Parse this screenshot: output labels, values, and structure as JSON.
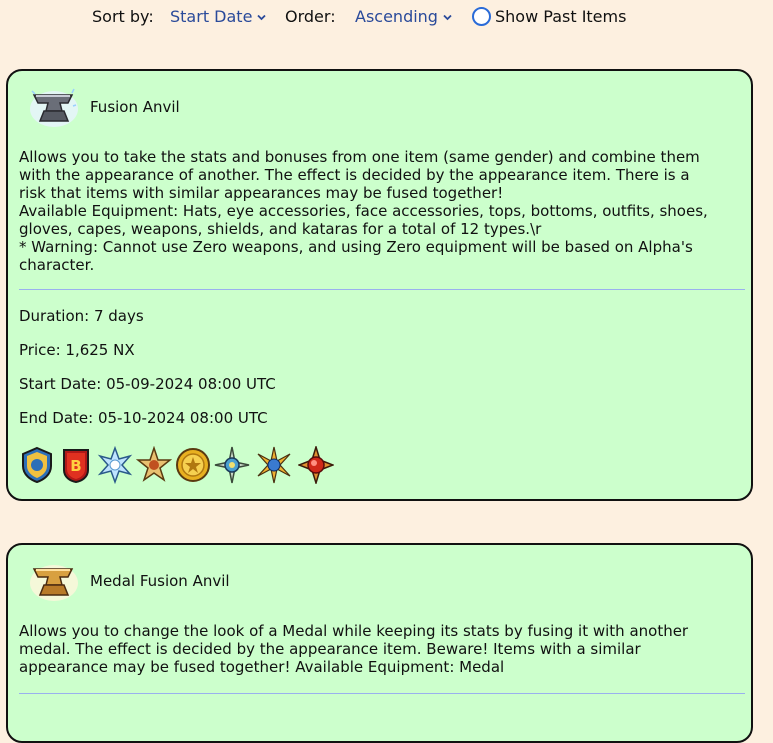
{
  "toolbar": {
    "sort_label": "Sort by:",
    "sort_value": "Start Date",
    "order_label": "Order:",
    "order_value": "Ascending",
    "past_label": "Show Past Items"
  },
  "items": [
    {
      "title": "Fusion Anvil",
      "icon": "anvil-icon",
      "description": "Allows you to take the stats and bonuses from one item (same gender) and combine them\nwith the appearance of another. The effect is decided by the appearance item. There is a\nrisk that items with similar appearances may be fused together!\nAvailable Equipment: Hats, eye accessories, face accessories, tops, bottoms, outfits, shoes,\ngloves, capes, weapons, shields, and kataras for a total of 12 types.\\r\n* Warning: Cannot use Zero weapons, and using Zero equipment will be based on Alpha's\ncharacter.",
      "duration": "Duration: 7 days",
      "price": "Price: 1,625 NX",
      "start": "Start Date: 05-09-2024 08:00 UTC",
      "end": "End Date: 05-10-2024 08:00 UTC",
      "medal_icons": [
        "shield-medal-icon",
        "crimson-b-medal-icon",
        "ice-star-medal-icon",
        "gold-star-medal-icon",
        "gold-coin-medal-icon",
        "compass-medal-icon",
        "blue-star-medal-icon",
        "red-orb-medal-icon"
      ]
    },
    {
      "title": "Medal Fusion Anvil",
      "icon": "gold-anvil-icon",
      "description": "Allows you to change the look of a Medal while keeping its stats by fusing it with another\nmedal. The effect is decided by the appearance item. Beware! Items with a similar\nappearance may be fused together! Available Equipment: Medal"
    }
  ],
  "colors": {
    "card_bg": "#ccffcc",
    "page_bg": "#fdf0e0",
    "accent": "#2a4a9a",
    "divider": "#9ab0ee"
  }
}
